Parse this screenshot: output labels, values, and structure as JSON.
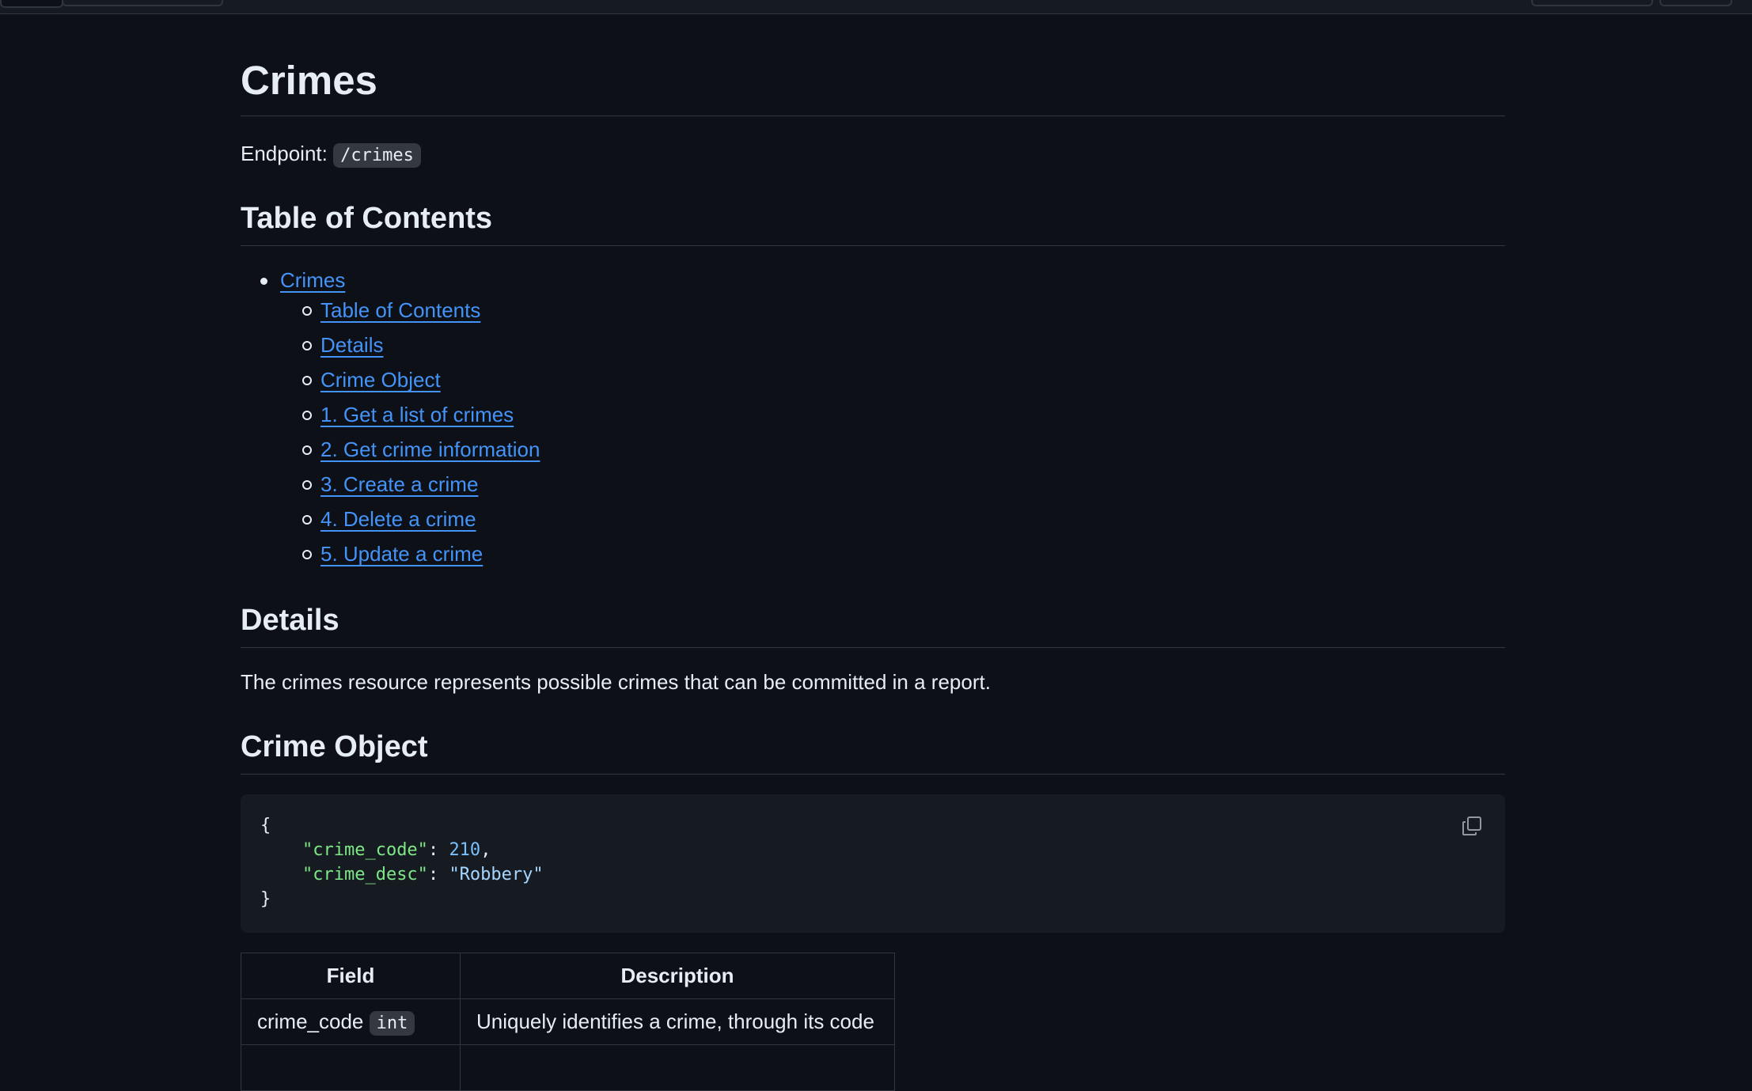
{
  "page": {
    "title": "Crimes",
    "endpoint_label": "Endpoint:",
    "endpoint_code": "/crimes"
  },
  "toc": {
    "heading": "Table of Contents",
    "root": "Crimes",
    "items": [
      "Table of Contents",
      "Details",
      "Crime Object",
      "1. Get a list of crimes",
      "2. Get crime information",
      "3. Create a crime",
      "4. Delete a crime",
      "5. Update a crime"
    ]
  },
  "details": {
    "heading": "Details",
    "text": "The crimes resource represents possible crimes that can be committed in a report."
  },
  "crime_object": {
    "heading": "Crime Object",
    "code": {
      "open": "{",
      "close": "}",
      "key1": "\"crime_code\"",
      "val1": "210",
      "key2": "\"crime_desc\"",
      "val2": "\"Robbery\""
    },
    "copy_icon": "copy-icon"
  },
  "table": {
    "headers": [
      "Field",
      "Description"
    ],
    "rows": [
      {
        "field": "crime_code",
        "type": "int",
        "description": "Uniquely identifies a crime, through its code"
      }
    ]
  },
  "colors": {
    "background": "#0d1117",
    "link": "#4493f8",
    "code_bg": "#161b22",
    "border": "#30363d"
  }
}
